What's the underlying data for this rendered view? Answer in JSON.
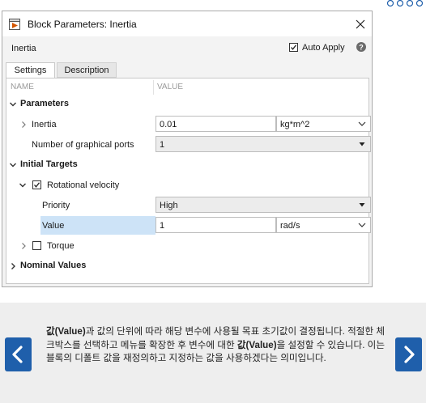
{
  "dialog": {
    "title": "Block Parameters: Inertia",
    "block_name": "Inertia",
    "auto_apply_label": "Auto Apply",
    "auto_apply_checked": true,
    "tabs": [
      {
        "label": "Settings",
        "active": true
      },
      {
        "label": "Description",
        "active": false
      }
    ],
    "columns": {
      "name": "NAME",
      "value": "VALUE"
    },
    "sections": {
      "parameters": "Parameters",
      "initial_targets": "Initial Targets",
      "nominal_values": "Nominal Values"
    },
    "params": {
      "inertia": {
        "label": "Inertia",
        "value": "0.01",
        "unit": "kg*m^2"
      },
      "ports": {
        "label": "Number of graphical ports",
        "value": "1"
      }
    },
    "targets": {
      "rot_vel": {
        "label": "Rotational velocity",
        "checked": true
      },
      "priority": {
        "label": "Priority",
        "value": "High"
      },
      "value": {
        "label": "Value",
        "value": "1",
        "unit": "rad/s"
      },
      "torque": {
        "label": "Torque",
        "checked": false
      }
    }
  },
  "caption": {
    "part1_bold": "값(Value)",
    "part1": "과 값의 단위에 따라 해당 변수에 사용될 목표 초기값이 결정됩니다. 적절한 체크박스를 선택하고 메뉴를 확장한 후 변수에 대한 ",
    "part2_bold": "값(Value)",
    "part2": "을 설정할 수 있습니다. 이는 블록의 디폴트 값을 재정의하고 지정하는 값을 사용하겠다는 의미입니다."
  },
  "nav": {
    "prev_icon": "chevron-left-icon",
    "next_icon": "chevron-right-icon"
  },
  "colors": {
    "nav_button": "#1f5fab",
    "selection": "#cde3f7"
  }
}
